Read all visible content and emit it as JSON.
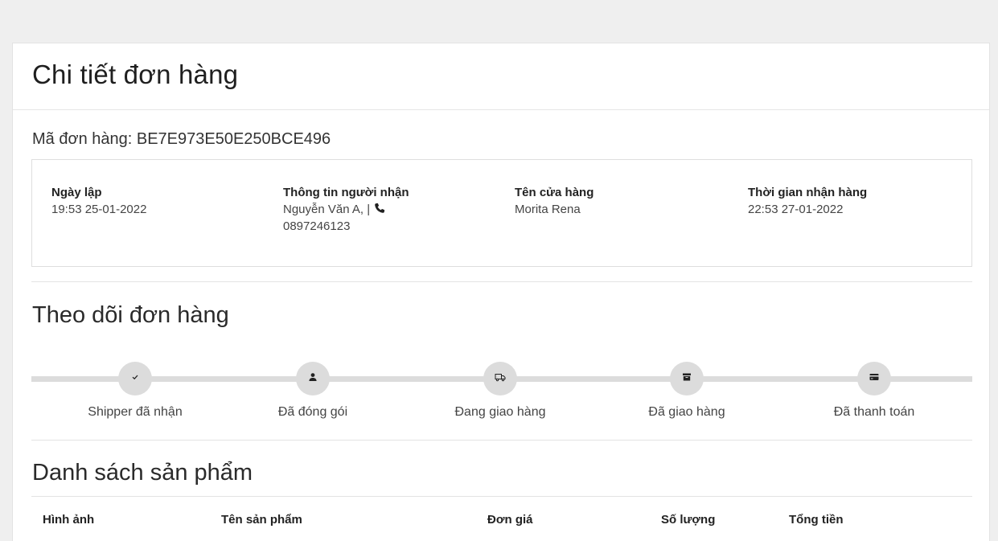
{
  "page": {
    "title": "Chi tiết đơn hàng"
  },
  "order": {
    "code_label": "Mã đơn hàng: BE7E973E50E250BCE496",
    "created_label": "Ngày lập",
    "created_value": "19:53 25-01-2022",
    "recipient_label": "Thông tin người nhận",
    "recipient_name": "Nguyễn Văn A, |",
    "recipient_phone": "0897246123",
    "store_label": "Tên cửa hàng",
    "store_value": "Morita Rena",
    "received_label": "Thời gian nhận hàng",
    "received_value": "22:53 27-01-2022"
  },
  "tracking": {
    "title": "Theo dõi đơn hàng",
    "steps": [
      {
        "label": "Shipper đã nhận",
        "icon": "check-icon"
      },
      {
        "label": "Đã đóng gói",
        "icon": "user-icon"
      },
      {
        "label": "Đang giao hàng",
        "icon": "truck-icon"
      },
      {
        "label": "Đã giao hàng",
        "icon": "archive-box-icon"
      },
      {
        "label": "Đã thanh toán",
        "icon": "credit-card-icon"
      }
    ]
  },
  "products": {
    "title": "Danh sách sản phẩm",
    "columns": [
      "Hình ảnh",
      "Tên sản phẩm",
      "Đơn giá",
      "Số lượng",
      "Tổng tiền"
    ]
  },
  "colors": {
    "page_bg": "#efefef",
    "card_bg": "#ffffff",
    "step_circle": "#dcdcdc",
    "icon": "#222222"
  }
}
